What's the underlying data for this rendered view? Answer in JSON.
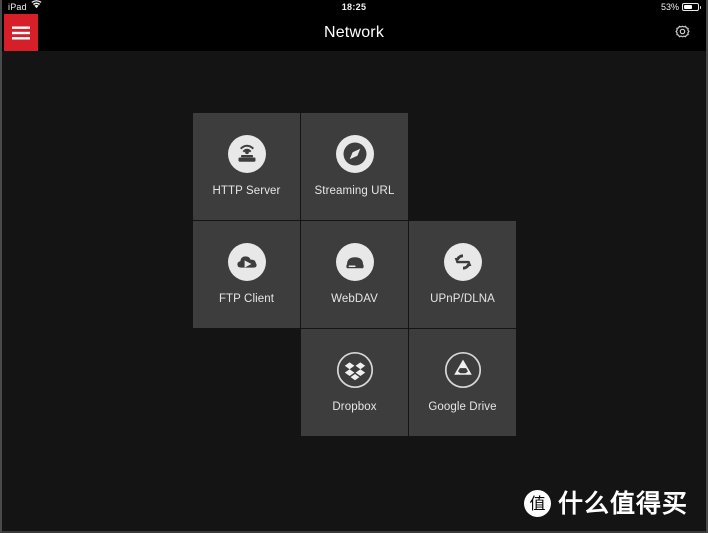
{
  "statusbar": {
    "carrier": "iPad",
    "wifi_icon": "wifi-icon",
    "time": "18:25",
    "battery_percent": "53%",
    "battery_level": 53,
    "battery_icon": "battery-icon"
  },
  "navbar": {
    "menu_icon": "hamburger-menu-icon",
    "title": "Network",
    "settings_icon": "gear-icon",
    "menu_button_color": "#d61f28"
  },
  "colors": {
    "background": "#141414",
    "tile": "#3d3d3d",
    "accent_red": "#d61f28",
    "icon_circle": "#e8e8e8",
    "label_text": "#e6e6e6"
  },
  "grid": {
    "columns": 3,
    "rows": 3,
    "cells": [
      {
        "position": "r1c1",
        "label": "HTTP Server",
        "icon": "http-server-icon",
        "icon_style": "filled",
        "empty": false
      },
      {
        "position": "r1c2",
        "label": "Streaming URL",
        "icon": "compass-icon",
        "icon_style": "filled",
        "empty": false
      },
      {
        "position": "r1c3",
        "label": "",
        "icon": "",
        "icon_style": "",
        "empty": true
      },
      {
        "position": "r2c1",
        "label": "FTP Client",
        "icon": "cloud-play-icon",
        "icon_style": "filled",
        "empty": false
      },
      {
        "position": "r2c2",
        "label": "WebDAV",
        "icon": "disk-drive-icon",
        "icon_style": "filled",
        "empty": false
      },
      {
        "position": "r2c3",
        "label": "UPnP/DLNA",
        "icon": "sync-arrows-icon",
        "icon_style": "filled",
        "empty": false
      },
      {
        "position": "r3c1",
        "label": "",
        "icon": "",
        "icon_style": "",
        "empty": true
      },
      {
        "position": "r3c2",
        "label": "Dropbox",
        "icon": "dropbox-icon",
        "icon_style": "outline",
        "empty": false
      },
      {
        "position": "r3c3",
        "label": "Google Drive",
        "icon": "google-drive-icon",
        "icon_style": "outline",
        "empty": false
      }
    ]
  },
  "watermark": {
    "badge": "值",
    "text": "什么值得买"
  }
}
